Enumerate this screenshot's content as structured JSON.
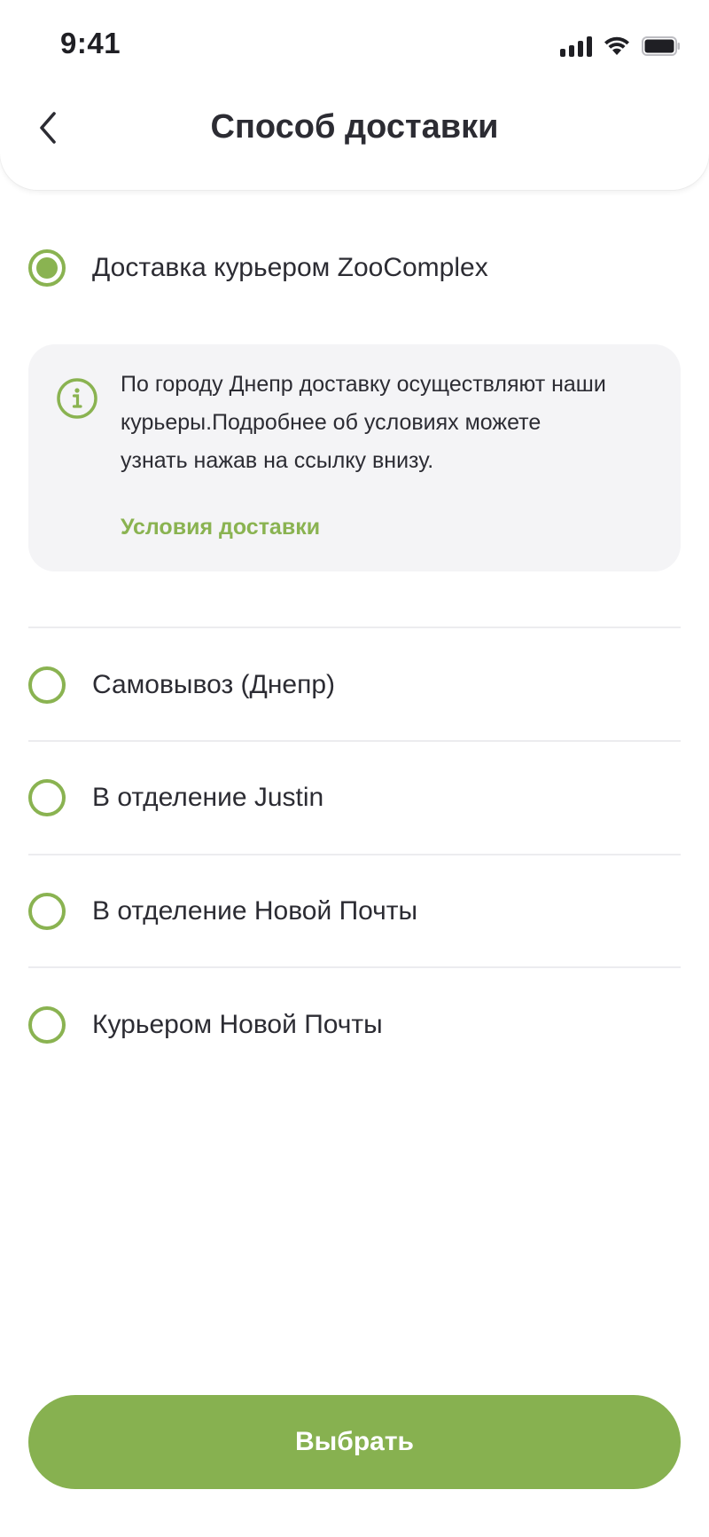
{
  "status_bar": {
    "time": "9:41",
    "signal_icon": "signal-bars-icon",
    "wifi_icon": "wifi-icon",
    "battery_icon": "battery-icon"
  },
  "header": {
    "back_icon": "chevron-left-icon",
    "title": "Способ доставки"
  },
  "options": [
    {
      "label": "Доставка курьером ZooComplex",
      "selected": true
    },
    {
      "label": "Самовывоз (Днепр)",
      "selected": false
    },
    {
      "label": "В отделение Justin",
      "selected": false
    },
    {
      "label": "В отделение Новой Почты",
      "selected": false
    },
    {
      "label": "Курьером Новой Почты",
      "selected": false
    }
  ],
  "info": {
    "icon": "info-icon",
    "lines": [
      "По городу Днепр доставку осуществляют наши",
      "курьеры.Подробнее об условиях можете",
      "узнать нажав на ссылку внизу."
    ],
    "link_label": "Условия доставки"
  },
  "action": {
    "select_label": "Выбрать"
  },
  "colors": {
    "accent": "#8ab351",
    "button": "#87b150",
    "text": "#2c2c33",
    "info_bg": "#f4f4f6"
  }
}
